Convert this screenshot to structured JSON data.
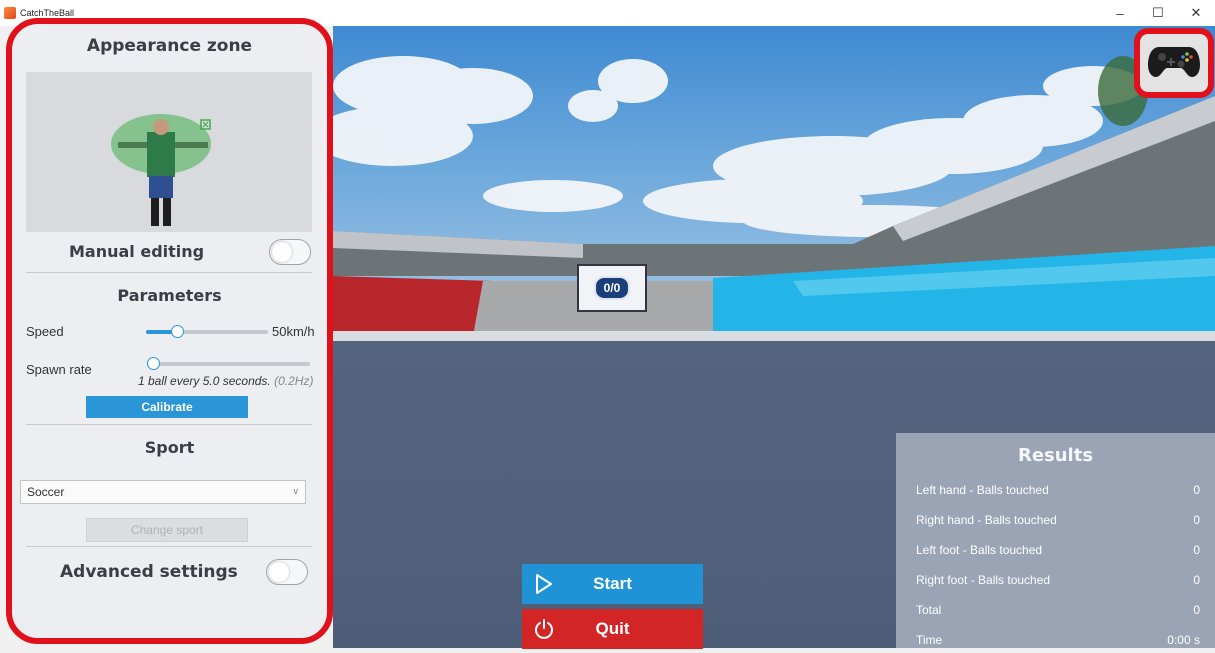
{
  "window": {
    "title": "CatchTheBall",
    "minimize": "–",
    "maximize": "☐",
    "close": "✕"
  },
  "panel": {
    "appearance_title": "Appearance zone",
    "manual_editing_label": "Manual editing",
    "parameters_title": "Parameters",
    "speed_label": "Speed",
    "speed_value": "50km/h",
    "speed_level": 0.25,
    "spawn_label": "Spawn rate",
    "spawn_text": "1 ball every 5.0 seconds.",
    "spawn_hz": "(0.2Hz)",
    "spawn_level": 0.03,
    "calibrate_label": "Calibrate",
    "sport_title": "Sport",
    "sport_selected": "Soccer",
    "change_sport_label": "Change sport",
    "advanced_label": "Advanced settings"
  },
  "scoreboard": {
    "value": "0/0"
  },
  "controls": {
    "start_label": "Start",
    "quit_label": "Quit"
  },
  "results": {
    "title": "Results",
    "rows": [
      {
        "label": "Left hand - Balls touched",
        "value": "0"
      },
      {
        "label": "Right hand - Balls touched",
        "value": "0"
      },
      {
        "label": "Left foot - Balls touched",
        "value": "0"
      },
      {
        "label": "Right foot - Balls touched",
        "value": "0"
      },
      {
        "label": "Total",
        "value": "0"
      },
      {
        "label": "Time",
        "value": "0:00 s"
      }
    ]
  },
  "colors": {
    "accent": "#2a96d8",
    "danger": "#d32426",
    "highlight": "#e0111a"
  },
  "icons": {
    "gamepad": "gamepad-icon",
    "start": "play-icon",
    "quit": "power-icon"
  }
}
